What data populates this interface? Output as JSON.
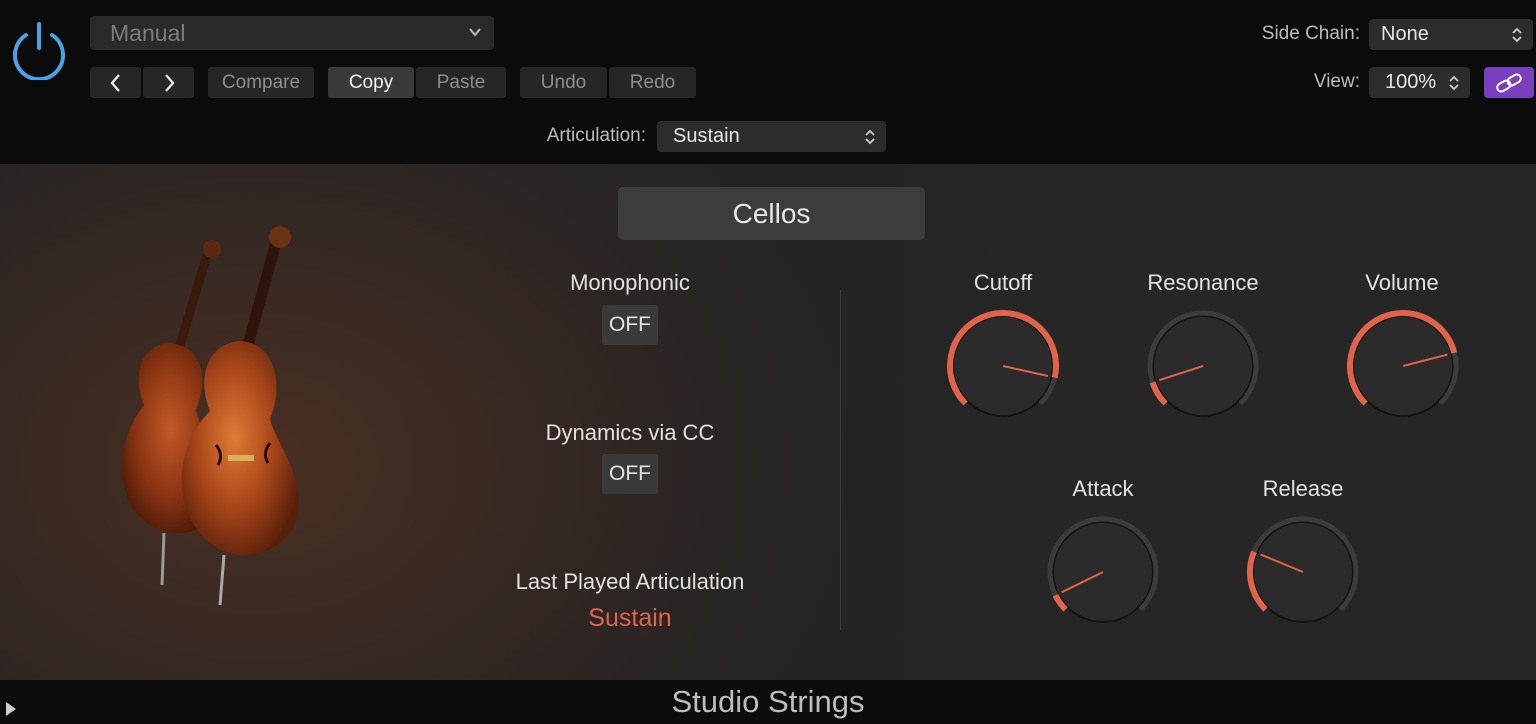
{
  "header": {
    "preset": "Manual",
    "nav": {
      "prev_icon": "chevron-left-icon",
      "next_icon": "chevron-right-icon"
    },
    "buttons": {
      "compare": "Compare",
      "copy": "Copy",
      "paste": "Paste",
      "undo": "Undo",
      "redo": "Redo"
    },
    "side_chain_label": "Side Chain:",
    "side_chain_value": "None",
    "view_label": "View:",
    "view_value": "100%",
    "link_icon": "link-icon",
    "articulation_label": "Articulation:",
    "articulation_value": "Sustain"
  },
  "main": {
    "instrument": "Cellos",
    "monophonic_label": "Monophonic",
    "monophonic_value": "OFF",
    "dynamics_label": "Dynamics via CC",
    "dynamics_value": "OFF",
    "last_played_label": "Last Played Articulation",
    "last_played_value": "Sustain",
    "knobs": {
      "cutoff": {
        "label": "Cutoff",
        "value": 0.88
      },
      "resonance": {
        "label": "Resonance",
        "value": 0.1
      },
      "volume": {
        "label": "Volume",
        "value": 0.78
      },
      "attack": {
        "label": "Attack",
        "value": 0.07
      },
      "release": {
        "label": "Release",
        "value": 0.25
      }
    }
  },
  "footer": {
    "title": "Studio Strings"
  },
  "colors": {
    "accent": "#e0634a",
    "link_button": "#7a3fbf",
    "power_icon": "#4aa3e8"
  }
}
